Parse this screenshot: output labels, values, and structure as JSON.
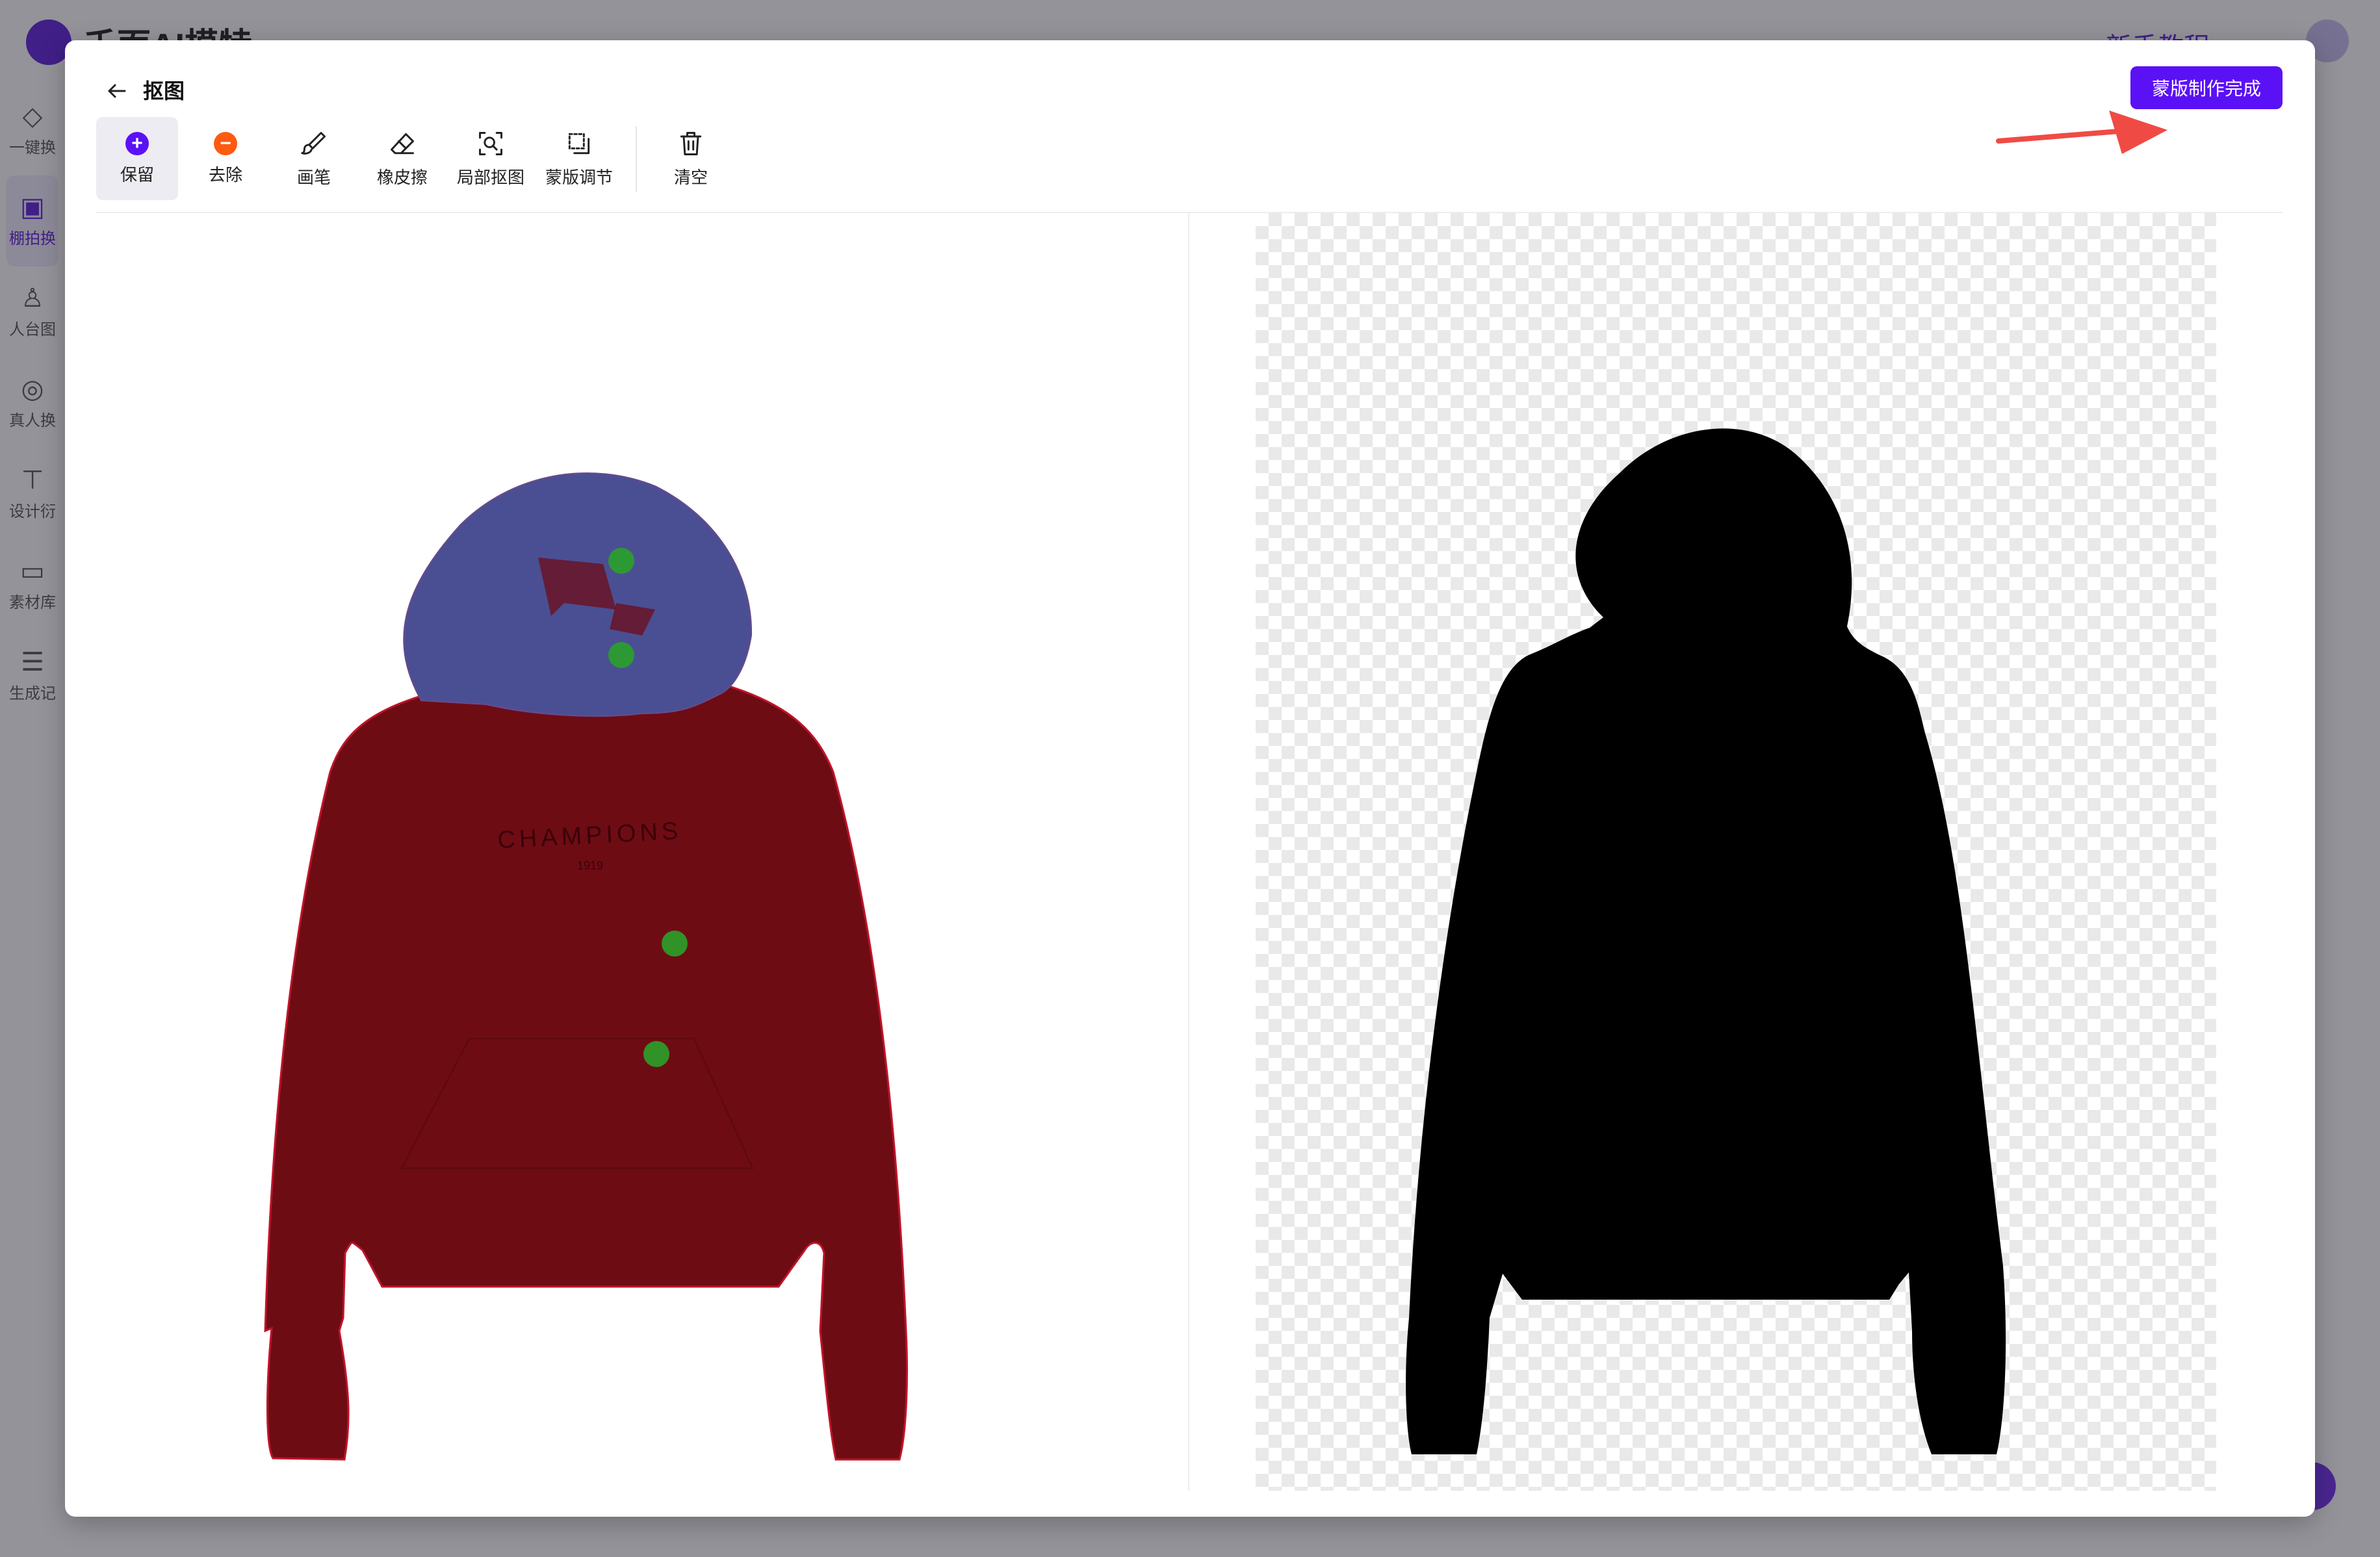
{
  "background_app": {
    "brand": "千面AI模特",
    "tutorial_link": "新手教程",
    "sidebar": [
      {
        "label": "一键换",
        "icon": "paint-bucket-icon"
      },
      {
        "label": "棚拍换",
        "icon": "studio-icon",
        "active": true
      },
      {
        "label": "人台图",
        "icon": "mannequin-icon"
      },
      {
        "label": "真人换",
        "icon": "person-swap-icon"
      },
      {
        "label": "设计衍",
        "icon": "shirt-icon"
      },
      {
        "label": "素材库",
        "icon": "folder-icon"
      },
      {
        "label": "生成记",
        "icon": "list-icon"
      }
    ]
  },
  "modal": {
    "title": "抠图",
    "done_button": "蒙版制作完成",
    "accent_color": "#5b11f5",
    "arrow_color": "#ef4b44",
    "toolbar": [
      {
        "label": "保留",
        "icon": "plus-circle-icon",
        "active": true
      },
      {
        "label": "去除",
        "icon": "minus-circle-icon"
      },
      {
        "label": "画笔",
        "icon": "brush-icon"
      },
      {
        "label": "橡皮擦",
        "icon": "eraser-icon"
      },
      {
        "label": "局部抠图",
        "icon": "partial-cutout-icon"
      },
      {
        "label": "蒙版调节",
        "icon": "mask-adjust-icon"
      }
    ],
    "clear_button": {
      "label": "清空",
      "icon": "trash-icon"
    },
    "editor": {
      "garment_text": "CHAMPIONS",
      "garment_subtext": "1919",
      "keep_point_color": "#2aa12a",
      "mask_color": "#7a0f16"
    },
    "preview": {
      "mask_color": "#000000",
      "background": "transparent-checkerboard"
    }
  }
}
